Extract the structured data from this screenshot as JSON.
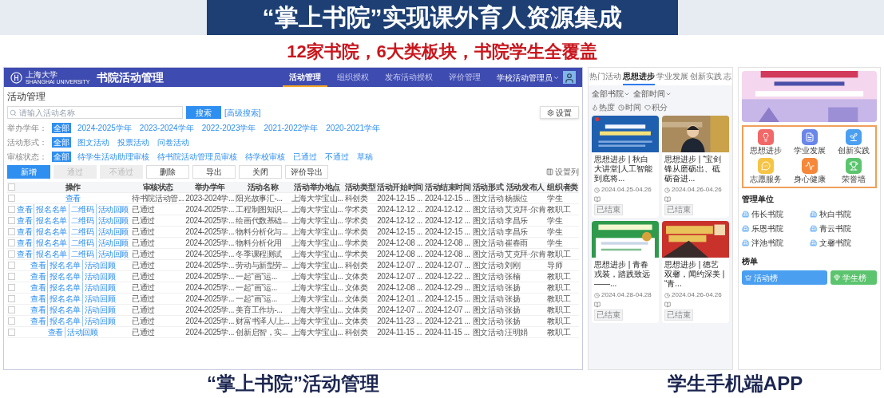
{
  "slide": {
    "title": "“掌上书院”实现课外育人资源集成",
    "subtitle": "12家书院，6大类板块，书院学生全覆盖",
    "captions": [
      "“掌上书院”活动管理",
      "学生手机端APP"
    ]
  },
  "admin": {
    "logo_text": "上海大学",
    "logo_subtext": "SHANGHAI UNIVERSITY",
    "app_title": "书院活动管理",
    "nav": [
      {
        "label": "活动管理",
        "selected": true
      },
      {
        "label": "组织授权",
        "selected": false
      },
      {
        "label": "发布活动授权",
        "selected": false
      },
      {
        "label": "评价管理",
        "selected": false
      }
    ],
    "user": "学校活动管理员",
    "heading": "活动管理",
    "search": {
      "placeholder": "请输入活动名称",
      "button": "搜索",
      "advanced": "[高级搜索]"
    },
    "settings_button": "设置",
    "filters": [
      {
        "label": "举办学年：",
        "options": [
          {
            "label": "全部",
            "selected": true
          },
          {
            "label": "2024-2025学年",
            "selected": false
          },
          {
            "label": "2023-2024学年",
            "selected": false
          },
          {
            "label": "2022-2023学年",
            "selected": false
          },
          {
            "label": "2021-2022学年",
            "selected": false
          },
          {
            "label": "2020-2021学年",
            "selected": false
          }
        ]
      },
      {
        "label": "活动形式：",
        "options": [
          {
            "label": "全部",
            "selected": true
          },
          {
            "label": "图文活动",
            "selected": false
          },
          {
            "label": "投票活动",
            "selected": false
          },
          {
            "label": "问卷活动",
            "selected": false
          }
        ]
      },
      {
        "label": "审核状态：",
        "options": [
          {
            "label": "全部",
            "selected": true
          },
          {
            "label": "待学生活动助理审核",
            "selected": false
          },
          {
            "label": "待书院活动管理员审核",
            "selected": false
          },
          {
            "label": "待学校审核",
            "selected": false
          },
          {
            "label": "已通过",
            "selected": false
          },
          {
            "label": "不通过",
            "selected": false
          },
          {
            "label": "草稿",
            "selected": false
          }
        ]
      }
    ],
    "actions": [
      {
        "label": "新增",
        "kind": "primary",
        "disabled": false
      },
      {
        "label": "通过",
        "kind": "plain",
        "disabled": true
      },
      {
        "label": "不通过",
        "kind": "plain",
        "disabled": true
      },
      {
        "label": "删除",
        "kind": "plain",
        "disabled": false
      },
      {
        "label": "导出",
        "kind": "plain",
        "disabled": false
      },
      {
        "label": "关闭",
        "kind": "plain",
        "disabled": false
      },
      {
        "label": "评价导出",
        "kind": "plain",
        "disabled": false
      }
    ],
    "column_settings": "设置列",
    "table": {
      "header_checked": false,
      "action_column": "操作",
      "columns": [
        "审核状态",
        "举办学年",
        "活动名称",
        "活动举办地点",
        "活动类型",
        "活动开始时间",
        "活动结束时间",
        "活动形式",
        "活动发布人",
        "组织者类"
      ],
      "rows": [
        {
          "checked": false,
          "actions": [
            "查看"
          ],
          "cells": [
            "待书院活动管...",
            "2023-2024学...",
            "阳光故事汇-...",
            "上海大学宝山...",
            "科创类",
            "2024-12-15 ...",
            "2024-12-15 ...",
            "图文活动",
            "杨振位",
            "学生"
          ]
        },
        {
          "checked": false,
          "actions": [
            "查看",
            "报名名单",
            "二维码",
            "活动回顾"
          ],
          "cells": [
            "已通过",
            "2024-2025学...",
            "工程制图知识...",
            "上海大学宝山...",
            "学术类",
            "2024-12-12 ...",
            "2024-12-12 ...",
            "图文活动",
            "艾克拜·尔肯",
            "教职工"
          ]
        },
        {
          "checked": false,
          "actions": [
            "查看",
            "报名名单",
            "二维码",
            "活动回顾"
          ],
          "cells": [
            "已通过",
            "2024-2025学...",
            "绘画代数基础...",
            "上海大学宝山...",
            "学术类",
            "2024-12-12 ...",
            "2024-12-12 ...",
            "图文活动",
            "李昌乐",
            "学生"
          ]
        },
        {
          "checked": false,
          "actions": [
            "查看",
            "报名名单",
            "二维码",
            "活动回顾"
          ],
          "cells": [
            "已通过",
            "2024-2025学...",
            "物料分析化与...",
            "上海大学宝山...",
            "学术类",
            "2024-12-15 ...",
            "2024-12-15 ...",
            "图文活动",
            "李昌乐",
            "学生"
          ]
        },
        {
          "checked": false,
          "actions": [
            "查看",
            "报名名单",
            "二维码",
            "活动回顾"
          ],
          "cells": [
            "已通过",
            "2024-2025学...",
            "物料分析化用",
            "上海大学宝山...",
            "学术类",
            "2024-12-08 ...",
            "2024-12-08 ...",
            "图文活动",
            "崔春雨",
            "学生"
          ]
        },
        {
          "checked": false,
          "actions": [
            "查看",
            "报名名单",
            "二维码",
            "活动回顾"
          ],
          "cells": [
            "已通过",
            "2024-2025学...",
            "冬季课程测试",
            "上海大学宝山...",
            "学术类",
            "2024-12-08 ...",
            "2024-12-08 ...",
            "图文活动",
            "艾克拜·尔肯",
            "教职工"
          ]
        },
        {
          "checked": false,
          "actions": [
            "查看",
            "报名名单",
            "活动回顾"
          ],
          "cells": [
            "已通过",
            "2024-2025学...",
            "劳动与新型劳...",
            "上海大学宝山...",
            "科创类",
            "2024-12-07 ...",
            "2024-12-07 ...",
            "图文活动",
            "刘刚",
            "导师"
          ]
        },
        {
          "checked": false,
          "actions": [
            "查看",
            "报名名单",
            "活动回顾"
          ],
          "cells": [
            "已通过",
            "2024-2025学...",
            "一起“画”运...",
            "上海大学宝山...",
            "文体类",
            "2024-12-07 ...",
            "2024-12-22 ...",
            "图文活动",
            "张楠",
            "教职工"
          ]
        },
        {
          "checked": false,
          "actions": [
            "查看",
            "报名名单",
            "活动回顾"
          ],
          "cells": [
            "已通过",
            "2024-2025学...",
            "一起“画”运...",
            "上海大学宝山...",
            "文体类",
            "2024-12-08 ...",
            "2024-12-29 ...",
            "图文活动",
            "张扬",
            "教职工"
          ]
        },
        {
          "checked": false,
          "actions": [
            "查看",
            "报名名单",
            "活动回顾"
          ],
          "cells": [
            "已通过",
            "2024-2025学...",
            "一起“画”运...",
            "上海大学宝山...",
            "文体类",
            "2024-12-01 ...",
            "2024-12-15 ...",
            "图文活动",
            "张扬",
            "教职工"
          ]
        },
        {
          "checked": false,
          "actions": [
            "查看",
            "报名名单",
            "活动回顾"
          ],
          "cells": [
            "已通过",
            "2024-2025学...",
            "美育工作坊-...",
            "上海大学宝山...",
            "文体类",
            "2024-12-07 ...",
            "2024-12-07 ...",
            "图文活动",
            "张扬",
            "教职工"
          ]
        },
        {
          "checked": false,
          "actions": [
            "查看",
            "报名名单",
            "活动回顾"
          ],
          "cells": [
            "已通过",
            "2024-2025学...",
            "财富书泽人/上...",
            "上海大学宝山...",
            "文体类",
            "2024-11-23 ...",
            "2024-12-21 ...",
            "图文活动",
            "张扬",
            "教职工"
          ]
        },
        {
          "checked": false,
          "actions": [
            "查看",
            "活动回顾"
          ],
          "cells": [
            "已通过",
            "2024-2025学...",
            "创新启智，实...",
            "上海大学宝山...",
            "科创类",
            "2024-11-15 ...",
            "2024-11-15 ...",
            "图文活动",
            "汪明娟",
            "教职工"
          ]
        }
      ]
    }
  },
  "phone_feed": {
    "tabs": [
      {
        "label": "热门活动",
        "selected": false
      },
      {
        "label": "思想进步",
        "selected": true
      },
      {
        "label": "学业发展",
        "selected": false
      },
      {
        "label": "创新实践",
        "selected": false
      },
      {
        "label": "志",
        "selected": false
      }
    ],
    "filters": [
      "全部书院",
      "全部时间"
    ],
    "sorts": [
      "热度",
      "时间",
      "积分"
    ],
    "cards": [
      {
        "title": "思想进步 | 秋白大讲堂|人工智能到底将...",
        "date": "2024.04.25-04.26",
        "status": "已结束"
      },
      {
        "title": "思想进步 | “宝剑锋从磨砺出、砥砺奋进...",
        "date": "2024.04.26-04.26",
        "status": "已结束"
      },
      {
        "title": "思想进步 | 青春戎装，踏践致远——...",
        "date": "2024.04.28-04.28",
        "status": "已结束"
      },
      {
        "title": "思想进步 | 德艺双馨，闻约深美 | “青...",
        "date": "2024.04.26-04.26",
        "status": "已结束"
      }
    ]
  },
  "phone_home": {
    "shortcuts": [
      {
        "label": "思想进步",
        "color": "#f26868"
      },
      {
        "label": "学业发展",
        "color": "#6a86e8"
      },
      {
        "label": "创新实践",
        "color": "#4a9ff0"
      },
      {
        "label": "志愿服务",
        "color": "#f6c445"
      },
      {
        "label": "身心健康",
        "color": "#f5883a"
      },
      {
        "label": "荣誉墙",
        "color": "#5cc46e"
      }
    ],
    "units_title": "管理单位",
    "units": [
      "伟长书院",
      "秋白书院",
      "乐恩书院",
      "青云书院",
      "泮池书院",
      "文馨书院"
    ],
    "rank_title": "榜单",
    "rank_buttons": [
      {
        "label": "活动榜",
        "color": "#4a9ff0"
      },
      {
        "label": "学生榜",
        "color": "#5cc46e"
      }
    ]
  }
}
